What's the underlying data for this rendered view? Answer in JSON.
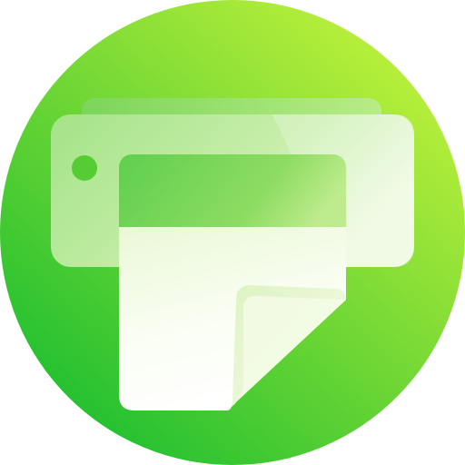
{
  "icon": {
    "name": "printer-icon",
    "colors": {
      "circle_light": "#C6F23A",
      "circle_mid": "#6FD83A",
      "circle_dark": "#1FBF2F",
      "printer_body": "#A7E58A",
      "printer_body_light": "#E9F8D8",
      "printer_top": "#8FDB6A",
      "indicator": "#55CC33",
      "paper_slot": "#6ED45A",
      "paper": "#F7FCEB",
      "paper_shadow": "#DDF2C6",
      "page_curl": "#EAF7D8"
    }
  }
}
